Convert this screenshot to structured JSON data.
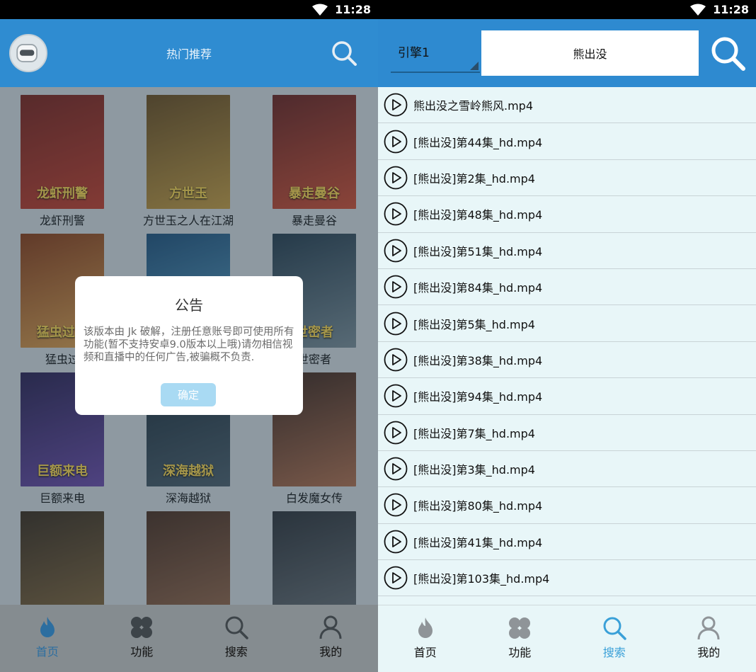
{
  "status": {
    "time": "11:28"
  },
  "left": {
    "header": {
      "title": "热门推荐"
    },
    "movies": [
      {
        "name": "龙虾刑警",
        "poster_text": "龙虾刑警",
        "color1": "#7a1f17",
        "color2": "#c43a27"
      },
      {
        "name": "方世玉之人在江湖",
        "poster_text": "方世玉",
        "color1": "#6a4a1b",
        "color2": "#c79b3c"
      },
      {
        "name": "暴走曼谷",
        "poster_text": "暴走曼谷",
        "color1": "#6b1f1a",
        "color2": "#d24b2e"
      },
      {
        "name": "猛虫过",
        "poster_text": "猛虫过江",
        "color1": "#8a3a13",
        "color2": "#e0a04a"
      },
      {
        "name": "",
        "poster_text": "",
        "color1": "#1d4f7a",
        "color2": "#5fa6c9"
      },
      {
        "name": "世密者",
        "poster_text": "世密者",
        "color1": "#243a4a",
        "color2": "#7a8c95"
      },
      {
        "name": "巨额来电",
        "poster_text": "巨额来电",
        "color1": "#2a1f4f",
        "color2": "#6b48a8"
      },
      {
        "name": "深海越狱",
        "poster_text": "深海越狱",
        "color1": "#1a2a36",
        "color2": "#4b5d69"
      },
      {
        "name": "白发魔女传",
        "poster_text": "",
        "color1": "#3d2318",
        "color2": "#b36e4a"
      },
      {
        "name": "",
        "poster_text": "",
        "color1": "#3a2a1a",
        "color2": "#8a6a3a"
      },
      {
        "name": "",
        "poster_text": "",
        "color1": "#4a2c1c",
        "color2": "#9c6a4a"
      },
      {
        "name": "",
        "poster_text": "",
        "color1": "#2c2f34",
        "color2": "#6d7378"
      }
    ],
    "dialog": {
      "title": "公告",
      "body": "该版本由 Jk 破解，注册任意账号即可使用所有功能(暂不支持安卓9.0版本以上哦)请勿相信视频和直播中的任何广告,被骗概不负责.",
      "ok_label": "确定"
    },
    "tabs": [
      {
        "label": "首页"
      },
      {
        "label": "功能"
      },
      {
        "label": "搜索"
      },
      {
        "label": "我的"
      }
    ]
  },
  "right": {
    "engine": {
      "value": "引擎1"
    },
    "search": {
      "value": "熊出没"
    },
    "results": [
      "熊出没之雪岭熊风.mp4",
      "[熊出没]第44集_hd.mp4",
      "[熊出没]第2集_hd.mp4",
      "[熊出没]第48集_hd.mp4",
      "[熊出没]第51集_hd.mp4",
      "[熊出没]第84集_hd.mp4",
      "[熊出没]第5集_hd.mp4",
      "[熊出没]第38集_hd.mp4",
      "[熊出没]第94集_hd.mp4",
      "[熊出没]第7集_hd.mp4",
      "[熊出没]第3集_hd.mp4",
      "[熊出没]第80集_hd.mp4",
      "[熊出没]第41集_hd.mp4",
      "[熊出没]第103集_hd.mp4"
    ],
    "tabs": [
      {
        "label": "首页"
      },
      {
        "label": "功能"
      },
      {
        "label": "搜索"
      },
      {
        "label": "我的"
      }
    ]
  }
}
